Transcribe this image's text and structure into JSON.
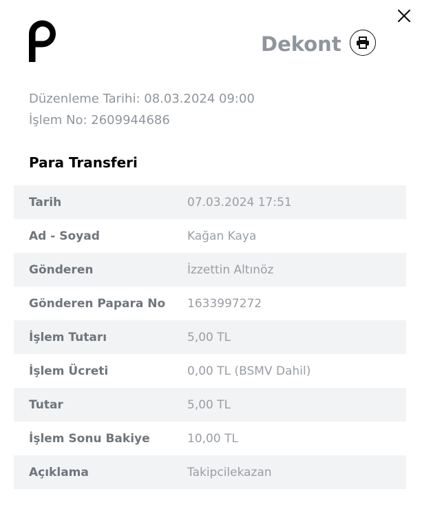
{
  "header": {
    "title": "Dekont"
  },
  "meta": {
    "date_line": "Düzenleme Tarihi: 08.03.2024 09:00",
    "txn_line": "İşlem No: 2609944686"
  },
  "section": {
    "title": "Para Transferi"
  },
  "rows": [
    {
      "label": "Tarih",
      "value": "07.03.2024 17:51"
    },
    {
      "label": "Ad - Soyad",
      "value": "Kağan Kaya"
    },
    {
      "label": "Gönderen",
      "value": "İzzettin Altınöz"
    },
    {
      "label": "Gönderen Papara No",
      "value": "1633997272"
    },
    {
      "label": "İşlem Tutarı",
      "value": "5,00 TL"
    },
    {
      "label": "İşlem Ücreti",
      "value": "0,00 TL (BSMV Dahil)"
    },
    {
      "label": "Tutar",
      "value": "5,00 TL"
    },
    {
      "label": "İşlem Sonu Bakiye",
      "value": "10,00 TL"
    },
    {
      "label": "Açıklama",
      "value": "Takipcilekazan"
    }
  ],
  "icons": {
    "close": "close-icon",
    "print": "printer-icon",
    "logo": "papara-logo"
  },
  "colors": {
    "title_gray": "#8f959c",
    "row_shade": "#f2f3f4",
    "label_gray": "#6f757c",
    "value_gray": "#999ea4"
  }
}
